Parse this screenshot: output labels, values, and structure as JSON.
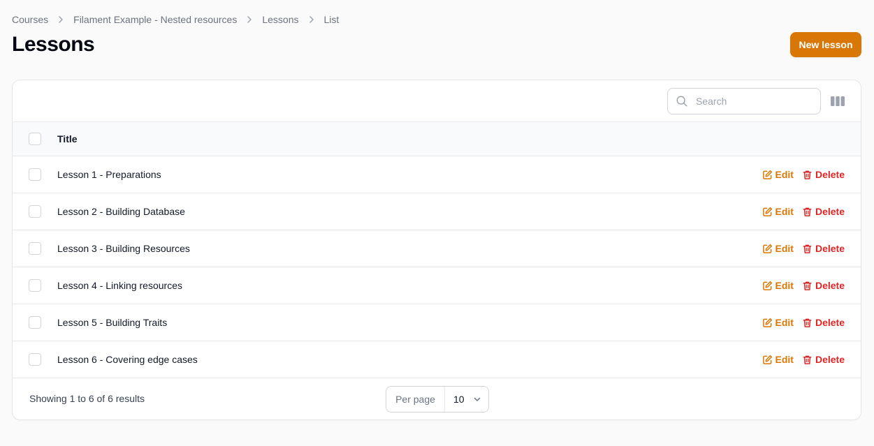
{
  "breadcrumb": [
    "Courses",
    "Filament Example - Nested resources",
    "Lessons",
    "List"
  ],
  "page": {
    "title": "Lessons",
    "new_button": "New lesson"
  },
  "table": {
    "search_placeholder": "Search",
    "column_title": "Title",
    "rows": [
      {
        "title": "Lesson 1 - Preparations",
        "edit": "Edit",
        "delete": "Delete"
      },
      {
        "title": "Lesson 2 - Building Database",
        "edit": "Edit",
        "delete": "Delete"
      },
      {
        "title": "Lesson 3 - Building Resources",
        "edit": "Edit",
        "delete": "Delete"
      },
      {
        "title": "Lesson 4 - Linking resources",
        "edit": "Edit",
        "delete": "Delete"
      },
      {
        "title": "Lesson 5 - Building Traits",
        "edit": "Edit",
        "delete": "Delete"
      },
      {
        "title": "Lesson 6 - Covering edge cases",
        "edit": "Edit",
        "delete": "Delete"
      }
    ],
    "footer": {
      "results": "Showing 1 to 6 of 6 results",
      "per_page_label": "Per page",
      "per_page_value": "10"
    }
  },
  "colors": {
    "accent": "#d97706",
    "danger": "#dc2626"
  },
  "icons": {
    "breadcrumb_sep": "chevron-right-icon",
    "search": "search-icon",
    "columns": "columns-icon",
    "edit": "edit-icon",
    "delete": "trash-icon",
    "dropdown": "chevron-down-icon"
  }
}
